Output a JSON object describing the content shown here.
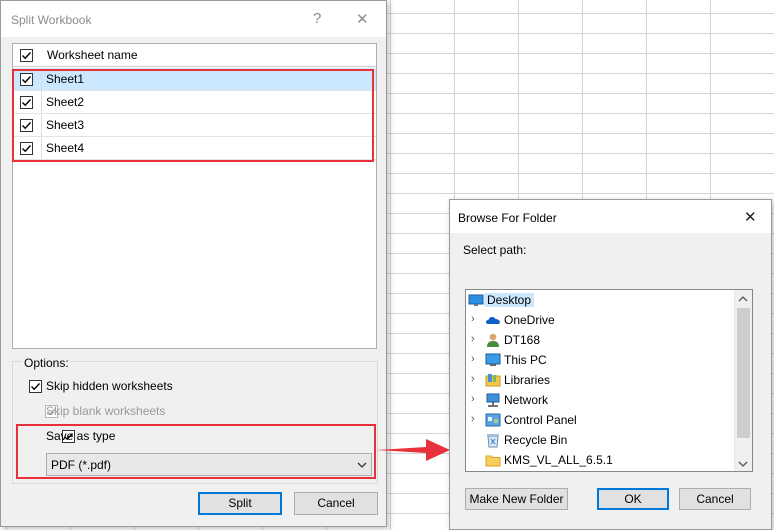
{
  "split_workbook": {
    "title": "Split Workbook",
    "help_glyph": "?",
    "close_glyph": "✕",
    "list_header": "Worksheet name",
    "sheets": [
      {
        "name": "Sheet1",
        "checked": true,
        "selected": true
      },
      {
        "name": "Sheet2",
        "checked": true,
        "selected": false
      },
      {
        "name": "Sheet3",
        "checked": true,
        "selected": false
      },
      {
        "name": "Sheet4",
        "checked": true,
        "selected": false
      }
    ],
    "options_label": "Options:",
    "skip_hidden": "Skip hidden worksheets",
    "skip_blank": "Skip blank worksheets",
    "save_as_type": "Save as type",
    "file_type": "PDF (*.pdf)",
    "split_button": "Split",
    "cancel_button": "Cancel"
  },
  "browse_folder": {
    "title": "Browse For Folder",
    "close_glyph": "✕",
    "select_path": "Select path:",
    "tree": [
      {
        "label": "Desktop",
        "icon": "desktop-icon",
        "selected": true
      },
      {
        "label": "OneDrive",
        "icon": "onedrive-icon"
      },
      {
        "label": "DT168",
        "icon": "user-icon"
      },
      {
        "label": "This PC",
        "icon": "computer-icon"
      },
      {
        "label": "Libraries",
        "icon": "libraries-icon"
      },
      {
        "label": "Network",
        "icon": "network-icon"
      },
      {
        "label": "Control Panel",
        "icon": "control-panel-icon"
      },
      {
        "label": "Recycle Bin",
        "icon": "recycle-bin-icon"
      },
      {
        "label": "KMS_VL_ALL_6.5.1",
        "icon": "folder-icon"
      }
    ],
    "make_new_folder": "Make New Folder",
    "ok_button": "OK",
    "cancel_button": "Cancel"
  },
  "colors": {
    "highlight": "#e8313a",
    "selection": "#cce8ff",
    "accent": "#0078d7"
  }
}
